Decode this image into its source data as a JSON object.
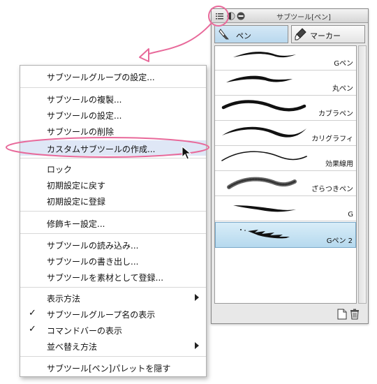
{
  "palette": {
    "title": "サブツール[ペン]",
    "tabs": [
      {
        "label": "ペン",
        "icon": "pen-icon",
        "active": true
      },
      {
        "label": "マーカー",
        "icon": "marker-icon",
        "active": false
      }
    ],
    "items": [
      {
        "name": "Gペン"
      },
      {
        "name": "丸ペン"
      },
      {
        "name": "カブラペン"
      },
      {
        "name": "カリグラフィ"
      },
      {
        "name": "効果線用"
      },
      {
        "name": "ざらつきペン"
      },
      {
        "name": "G"
      },
      {
        "name": "Gペン 2",
        "selected": true
      }
    ]
  },
  "menu": {
    "items": [
      {
        "label": "サブツールグループの設定..."
      },
      {
        "separator": true
      },
      {
        "label": "サブツールの複製..."
      },
      {
        "label": "サブツールの設定..."
      },
      {
        "label": "サブツールの削除"
      },
      {
        "label": "カスタムサブツールの作成...",
        "highlighted": true
      },
      {
        "separator": true
      },
      {
        "label": "ロック"
      },
      {
        "label": "初期設定に戻す"
      },
      {
        "label": "初期設定に登録"
      },
      {
        "separator": true
      },
      {
        "label": "修飾キー設定..."
      },
      {
        "separator": true
      },
      {
        "label": "サブツールの読み込み..."
      },
      {
        "label": "サブツールの書き出し..."
      },
      {
        "label": "サブツールを素材として登録..."
      },
      {
        "separator": true
      },
      {
        "label": "表示方法",
        "submenu": true
      },
      {
        "label": "サブツールグループ名の表示",
        "checked": true
      },
      {
        "label": "コマンドバーの表示",
        "checked": true
      },
      {
        "label": "並べ替え方法",
        "submenu": true
      },
      {
        "separator": true
      },
      {
        "label": "サブツール[ペン]パレットを隠す"
      }
    ]
  },
  "colors": {
    "annotation": "#e8699a",
    "selected_item": "#b6d9ee",
    "menu_highlight": "#dfe7f6"
  }
}
